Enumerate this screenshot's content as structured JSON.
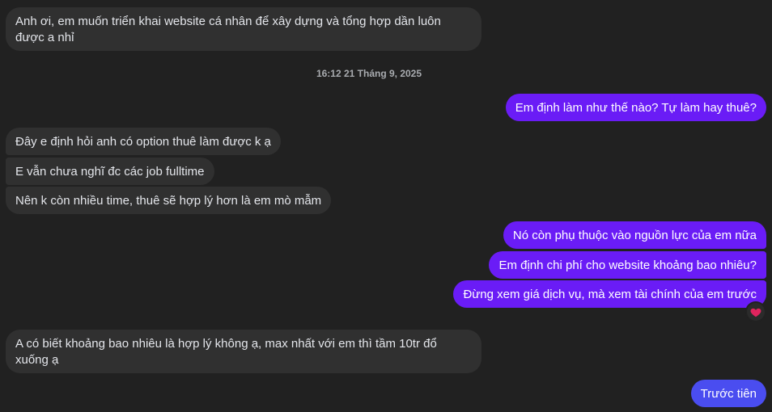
{
  "messages": {
    "m1": "Anh ơi, em muốn triển khai website cá nhân để xây dựng và tổng hợp dần luôn được a nhỉ",
    "timestamp": "16:12 21 Tháng 9, 2025",
    "m2": "Em định làm như thế nào? Tự làm hay thuê?",
    "m3": "Đây e định hỏi anh có option thuê làm được k ạ",
    "m4": "E vẫn chưa nghĩ đc các job fulltime",
    "m5": "Nên k còn nhiều time, thuê sẽ hợp lý hơn là em mò mẫm",
    "m6": "Nó còn phụ thuộc vào nguồn lực của em nữa",
    "m7": "Em định chi phí cho website khoảng bao nhiêu?",
    "m8": "Đừng xem giá dịch vụ, mà xem tài chính của em trước",
    "m9": "A có biết khoảng bao nhiêu là hợp lý không ạ, max nhất với em thì tầm 10tr đổ xuống ạ",
    "m10": "Trước tiên"
  },
  "reaction": {
    "icon": "heart-icon",
    "color": "#e0245e"
  },
  "colors": {
    "background": "#212121",
    "incoming": "#303030",
    "outgoing": "#6a1cf6",
    "outgoing_last": "#4a4df0"
  }
}
